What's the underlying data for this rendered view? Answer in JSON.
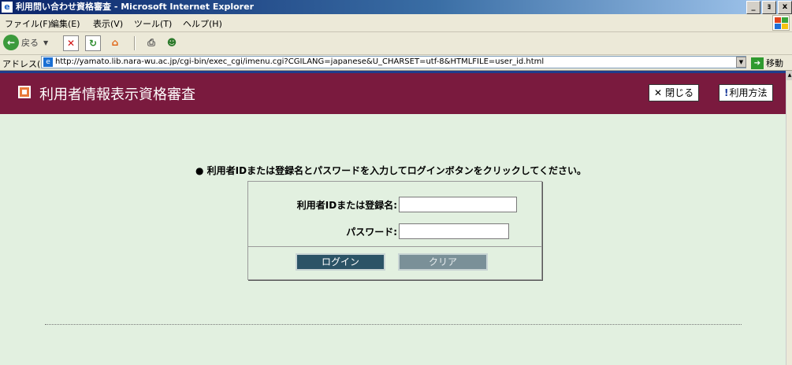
{
  "window": {
    "title": "利用問い合わせ資格審査 - Microsoft Internet Explorer",
    "buttons": [
      "_",
      "ｮ",
      "x"
    ]
  },
  "menu": [
    "ファイル(F)",
    "編集(E)",
    "表示(V)",
    "ツール(T)",
    "ヘルプ(H)"
  ],
  "toolbar": {
    "back_label": "戻る"
  },
  "address": {
    "label": "アドレス(D)",
    "url": "http://yamato.lib.nara-wu.ac.jp/cgi-bin/exec_cgi/imenu.cgi?CGILANG=japanese&U_CHARSET=utf-8&HTMLFILE=user_id.html",
    "go_label": "移動"
  },
  "page": {
    "title": "利用者情報表示資格審査",
    "close_label": "閉じる",
    "help_label": "利用方法",
    "instruction": "● 利用者IDまたは登録名とパスワードを入力してログインボタンをクリックしてください。",
    "user_label": "利用者IDまたは登録名:",
    "password_label": "パスワード:",
    "login_label": "ログイン",
    "clear_label": "クリア"
  },
  "colors": {
    "header": "#7a1a3e",
    "content_bg": "#e2f0e0",
    "login_button": "#2b5366"
  }
}
